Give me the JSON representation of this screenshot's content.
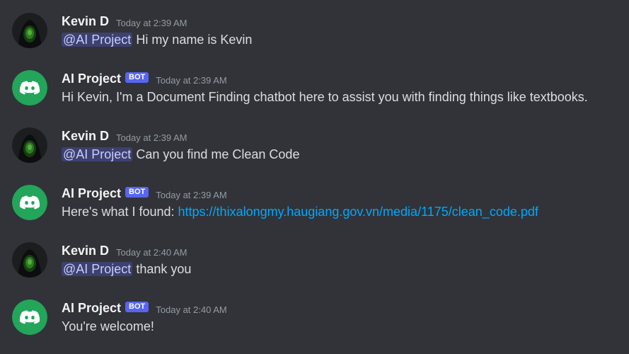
{
  "messages": [
    {
      "author": "Kevin D",
      "is_bot": false,
      "timestamp": "Today at 2:39 AM",
      "mention": "@AI Project",
      "text": " Hi my name is Kevin"
    },
    {
      "author": "AI Project",
      "is_bot": true,
      "bot_tag": "BOT",
      "timestamp": "Today at 2:39 AM",
      "text": "Hi Kevin, I'm a Document Finding chatbot here to assist you with finding things like textbooks."
    },
    {
      "author": "Kevin D",
      "is_bot": false,
      "timestamp": "Today at 2:39 AM",
      "mention": "@AI Project",
      "text": " Can you find me Clean Code"
    },
    {
      "author": "AI Project",
      "is_bot": true,
      "bot_tag": "BOT",
      "timestamp": "Today at 2:39 AM",
      "text": "Here's what I found: ",
      "link": "https://thixalongmy.haugiang.gov.vn/media/1175/clean_code.pdf"
    },
    {
      "author": "Kevin D",
      "is_bot": false,
      "timestamp": "Today at 2:40 AM",
      "mention": "@AI Project",
      "text": " thank you"
    },
    {
      "author": "AI Project",
      "is_bot": true,
      "bot_tag": "BOT",
      "timestamp": "Today at 2:40 AM",
      "text": "You're welcome!"
    }
  ],
  "icons": {
    "user_avatar": "hooded-figure-avatar-icon",
    "bot_avatar": "discord-logo-icon"
  },
  "colors": {
    "background": "#313338",
    "bot_avatar_bg": "#23a55a",
    "bot_tag": "#5865f2",
    "link": "#00a8fc",
    "mention_bg": "#3c4270",
    "timestamp": "#949ba4"
  }
}
